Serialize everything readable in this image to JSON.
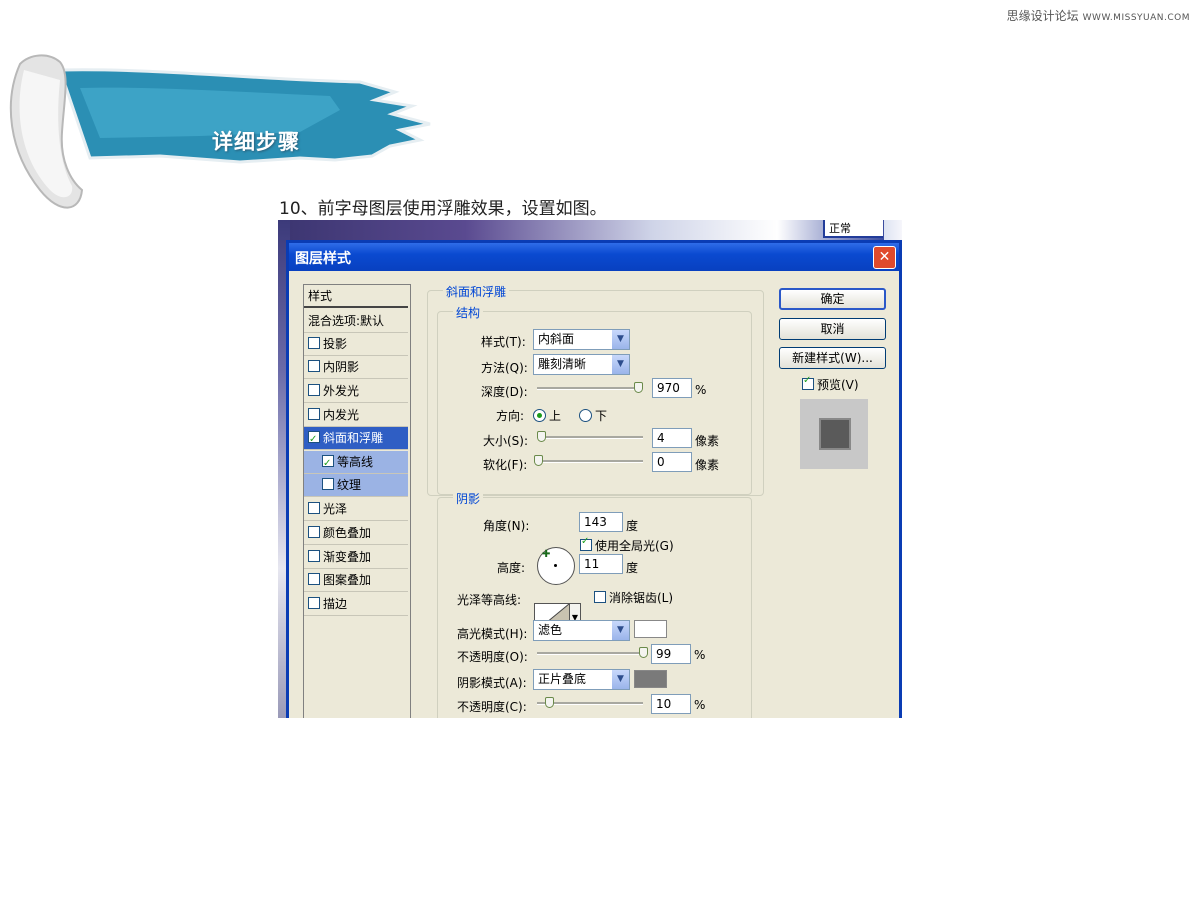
{
  "watermark": {
    "text": "思缘设计论坛",
    "site": "WWW.MISSYUAN.COM"
  },
  "banner": {
    "title": "详细步骤"
  },
  "caption": "10、前字母图层使用浮雕效果，设置如图。",
  "background": {
    "top_right_label": "正常"
  },
  "dialog": {
    "title": "图层样式",
    "close": "✕",
    "styles_list": {
      "header": "样式",
      "blend": "混合选项:默认",
      "items": [
        {
          "label": "投影",
          "checked": false
        },
        {
          "label": "内阴影",
          "checked": false
        },
        {
          "label": "外发光",
          "checked": false
        },
        {
          "label": "内发光",
          "checked": false
        },
        {
          "label": "斜面和浮雕",
          "checked": true
        },
        {
          "label": "等高线",
          "checked": true
        },
        {
          "label": "纹理",
          "checked": false
        },
        {
          "label": "光泽",
          "checked": false
        },
        {
          "label": "颜色叠加",
          "checked": false
        },
        {
          "label": "渐变叠加",
          "checked": false
        },
        {
          "label": "图案叠加",
          "checked": false
        },
        {
          "label": "描边",
          "checked": false
        }
      ]
    },
    "bevel": {
      "section_title": "斜面和浮雕",
      "structure_title": "结构",
      "style_label": "样式(T):",
      "style_value": "内斜面",
      "technique_label": "方法(Q):",
      "technique_value": "雕刻清晰",
      "depth_label": "深度(D):",
      "depth_value": "970",
      "depth_unit": "%",
      "depth_level": 0.97,
      "direction_label": "方向:",
      "direction_up": "上",
      "direction_down": "下",
      "size_label": "大小(S):",
      "size_value": "4",
      "size_unit": "像素",
      "size_level": 0.02,
      "soften_label": "软化(F):",
      "soften_value": "0",
      "soften_unit": "像素",
      "soften_level": 0.0
    },
    "shading": {
      "section_title": "阴影",
      "angle_label": "角度(N):",
      "angle_value": "143",
      "angle_unit": "度",
      "global_light": "使用全局光(G)",
      "altitude_label": "高度:",
      "altitude_value": "11",
      "altitude_unit": "度",
      "gloss_contour_label": "光泽等高线:",
      "anti_alias": "消除锯齿(L)",
      "highlight_mode_label": "高光模式(H):",
      "highlight_mode_value": "滤色",
      "highlight_color": "#ffffff",
      "highlight_opacity_label": "不透明度(O):",
      "highlight_opacity_value": "99",
      "highlight_opacity_unit": "%",
      "highlight_opacity_level": 0.99,
      "shadow_mode_label": "阴影模式(A):",
      "shadow_mode_value": "正片叠底",
      "shadow_color": "#7a7a7a",
      "shadow_opacity_label": "不透明度(C):",
      "shadow_opacity_value": "10",
      "shadow_opacity_unit": "%",
      "shadow_opacity_level": 0.1
    },
    "buttons": {
      "ok": "确定",
      "cancel": "取消",
      "new_style": "新建样式(W)...",
      "preview": "预览(V)"
    }
  }
}
